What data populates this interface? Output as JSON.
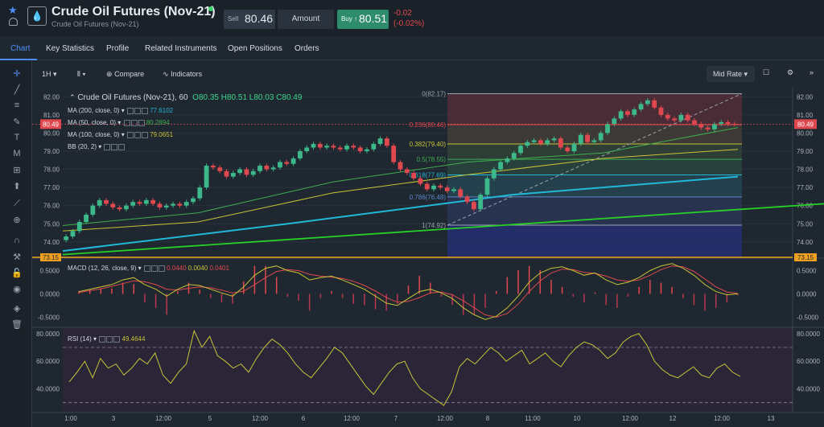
{
  "header": {
    "title": "Crude Oil Futures (Nov-21)",
    "subtitle": "Crude Oil Futures (Nov-21)",
    "sell_label": "Sell",
    "sell_price": "80.46",
    "amount_label": "Amount",
    "buy_label": "Buy ↑",
    "buy_price": "80.51",
    "change": "-0.02",
    "change_pct": "(-0.02%)",
    "logo_glyph": "💧"
  },
  "tabs": [
    "Chart",
    "Key Statistics",
    "Profile",
    "Related Instruments",
    "Open Positions",
    "Orders"
  ],
  "toolbar": {
    "interval": "1H",
    "compare": "Compare",
    "indicators": "Indicators",
    "rate": "Mid Rate"
  },
  "legend": {
    "symbol": "Crude Oil Futures (Nov-21), 60",
    "open": "O80.35",
    "high": "H80.51",
    "low": "L80.03",
    "close": "C80.49",
    "ma200": "MA (200, close, 0)",
    "ma200_val": "77.6102",
    "ma50": "MA (50, close, 0)",
    "ma50_val": "80.2894",
    "ma100": "MA (100, close, 0)",
    "ma100_val": "79.0651",
    "bb": "BB (20, 2)",
    "macd": "MACD (12, 26, close, 9)",
    "macd_v1": "0.0440",
    "macd_v2": "0.0040",
    "macd_v3": "0.0401",
    "rsi": "RSI (14)",
    "rsi_val": "49.4644"
  },
  "colors": {
    "ma200": "#22b8d8",
    "ma50": "#3fae4f",
    "ma100": "#c8c437",
    "trend": "#27d127",
    "up": "#3cb88a",
    "down": "#e0484f",
    "macd": "#c8c437",
    "signal": "#e0484f",
    "rsi": "#c8c437",
    "accent": "#4c8ef7"
  },
  "chart_data": {
    "type": "candlestick",
    "y_ticks": [
      "82.00",
      "81.00",
      "80.00",
      "79.00",
      "78.00",
      "77.00",
      "76.00",
      "75.00",
      "74.00"
    ],
    "y_range": [
      73.15,
      82.5
    ],
    "x_ticks": [
      "1:00",
      "3",
      "12:00",
      "5",
      "12:00",
      "6",
      "12:00",
      "7",
      "12:00",
      "8",
      "11:00",
      "10",
      "12:00",
      "12",
      "12:00",
      "13"
    ],
    "last_price": "80.49",
    "last_price_value": 80.49,
    "low_marker": "73.15",
    "low_marker_value": 73.15,
    "closes": [
      74.3,
      74.6,
      75.1,
      75.5,
      76.0,
      76.3,
      76.1,
      75.9,
      75.8,
      76.0,
      76.2,
      76.1,
      76.3,
      76.1,
      75.9,
      76.0,
      76.1,
      76.0,
      76.2,
      76.4,
      77.0,
      78.2,
      78.1,
      77.9,
      77.6,
      77.8,
      78.0,
      77.7,
      77.9,
      78.2,
      78.0,
      78.1,
      78.4,
      78.3,
      78.6,
      79.0,
      79.2,
      79.4,
      79.2,
      79.3,
      79.2,
      79.1,
      79.3,
      79.2,
      79.0,
      79.1,
      79.4,
      79.7,
      79.3,
      78.4,
      78.0,
      77.8,
      77.5,
      77.2,
      76.9,
      77.1,
      77.0,
      76.8,
      76.9,
      76.5,
      76.2,
      75.8,
      76.6,
      77.5,
      78.0,
      78.4,
      78.6,
      78.9,
      79.3,
      79.5,
      79.6,
      79.4,
      79.6,
      79.7,
      79.2,
      79.0,
      79.4,
      79.9,
      79.5,
      79.6,
      80.0,
      80.5,
      80.8,
      81.2,
      81.0,
      81.3,
      81.6,
      81.8,
      81.4,
      81.0,
      80.8,
      80.7,
      81.0,
      80.7,
      80.5,
      80.3,
      80.2,
      80.5,
      80.6,
      80.5,
      80.49
    ],
    "ma200": [
      73.5,
      75.0,
      76.6,
      77.6
    ],
    "ma50": [
      74.9,
      75.6,
      77.3,
      78.4,
      78.9,
      80.3
    ],
    "ma100": [
      74.6,
      75.1,
      76.7,
      77.7,
      78.6,
      79.1
    ],
    "fibonacci": [
      {
        "label": "0(82.17)",
        "value": 82.17
      },
      {
        "label": "0.236(80.46)",
        "value": 80.46
      },
      {
        "label": "0.382(79.40)",
        "value": 79.4
      },
      {
        "label": "0.5(78.55)",
        "value": 78.55
      },
      {
        "label": "0.618(77.69)",
        "value": 77.69
      },
      {
        "label": "0.786(76.48)",
        "value": 76.48
      },
      {
        "label": "1(74.92)",
        "value": 74.92
      }
    ],
    "trendline": [
      73.3,
      76.1
    ],
    "macd_ticks": [
      "0.5000",
      "0.0000",
      "-0.5000"
    ],
    "macd_range": [
      -0.7,
      0.75
    ],
    "macd": [
      0.05,
      0.1,
      0.15,
      0.2,
      0.3,
      0.35,
      0.2,
      0.1,
      -0.05,
      0.1,
      0.2,
      0.18,
      0.1,
      0.02,
      -0.05,
      0.15,
      0.4,
      0.55,
      0.6,
      0.5,
      0.45,
      0.3,
      0.35,
      0.38,
      0.3,
      0.2,
      0.1,
      -0.05,
      -0.2,
      -0.25,
      -0.1,
      0.05,
      0.1,
      0.02,
      -0.1,
      -0.3,
      -0.45,
      -0.55,
      -0.48,
      -0.3,
      -0.05,
      0.25,
      0.45,
      0.55,
      0.58,
      0.5,
      0.4,
      0.45,
      0.3,
      0.2,
      0.25,
      0.35,
      0.5,
      0.6,
      0.65,
      0.55,
      0.4,
      0.2,
      0.05,
      -0.02,
      0.0
    ],
    "signal": [
      0.03,
      0.07,
      0.11,
      0.16,
      0.22,
      0.28,
      0.26,
      0.2,
      0.1,
      0.08,
      0.12,
      0.15,
      0.13,
      0.08,
      0.02,
      0.06,
      0.2,
      0.35,
      0.48,
      0.52,
      0.5,
      0.42,
      0.38,
      0.36,
      0.33,
      0.27,
      0.18,
      0.06,
      -0.08,
      -0.18,
      -0.16,
      -0.08,
      0.02,
      0.04,
      -0.02,
      -0.15,
      -0.3,
      -0.45,
      -0.5,
      -0.42,
      -0.22,
      0.05,
      0.28,
      0.45,
      0.53,
      0.52,
      0.46,
      0.44,
      0.38,
      0.3,
      0.27,
      0.3,
      0.4,
      0.52,
      0.6,
      0.58,
      0.48,
      0.32,
      0.15,
      0.04,
      0.01
    ],
    "rsi_ticks": [
      "80.0000",
      "60.0000",
      "40.0000"
    ],
    "rsi_range": [
      24,
      84
    ],
    "rsi_bands": [
      70,
      30
    ],
    "rsi": [
      45,
      52,
      60,
      48,
      62,
      55,
      58,
      50,
      55,
      62,
      58,
      66,
      50,
      44,
      52,
      58,
      82,
      70,
      78,
      64,
      60,
      55,
      58,
      52,
      62,
      70,
      76,
      72,
      66,
      58,
      52,
      48,
      55,
      62,
      70,
      66,
      58,
      50,
      42,
      36,
      44,
      52,
      58,
      60,
      48,
      40,
      36,
      32,
      28,
      38,
      56,
      62,
      58,
      64,
      70,
      66,
      60,
      64,
      68,
      58,
      62,
      66,
      60,
      56,
      64,
      70,
      74,
      72,
      68,
      62,
      66,
      74,
      78,
      80,
      72,
      60,
      54,
      50,
      48,
      52,
      56,
      50,
      48,
      55,
      58,
      52,
      49
    ]
  }
}
